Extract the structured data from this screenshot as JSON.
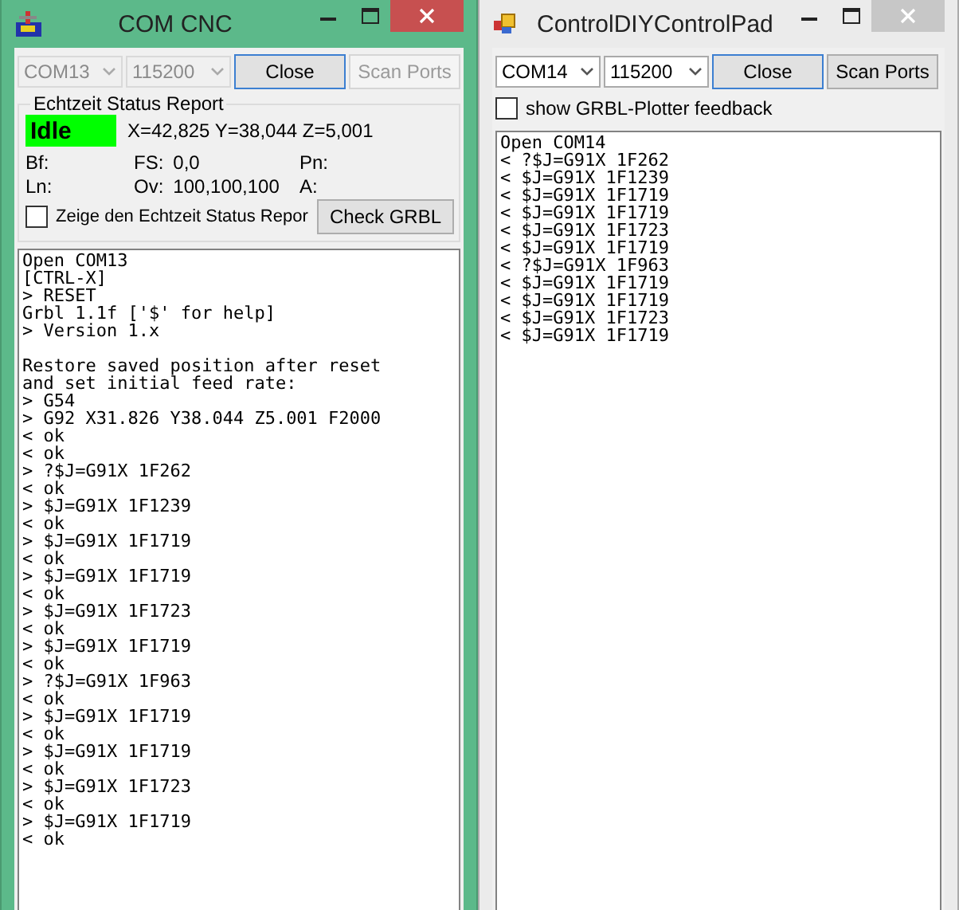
{
  "windows": [
    {
      "kind": "cnc",
      "title": "COM CNC",
      "active": true,
      "port": {
        "value": "COM13",
        "disabled": true
      },
      "baud": {
        "value": "115200",
        "disabled": true
      },
      "buttons": [
        {
          "label": "Close",
          "disabled": false,
          "focused": true
        },
        {
          "label": "Scan Ports",
          "disabled": true,
          "focused": false
        }
      ],
      "status": {
        "title": "Echtzeit Status Report",
        "state": "Idle",
        "position": "X=42,825 Y=38,044 Z=5,001",
        "fields": [
          {
            "label": "Bf:"
          },
          {
            "label": "FS:",
            "value": "0,0"
          },
          {
            "label": "Pn:"
          },
          {
            "label": "Ln:"
          },
          {
            "label": "Ov:",
            "value": "100,100,100"
          },
          {
            "label": "A:"
          }
        ],
        "show_status": {
          "label": "Zeige den Echtzeit Status Repor",
          "checked": false
        },
        "check_button": "Check GRBL"
      },
      "log": [
        [
          "Open COM13",
          "[CTRL-X]",
          "> RESET",
          "Grbl 1.1f ['$' for help]",
          "> Version 1.x"
        ],
        [
          "Restore saved position after reset",
          "and set initial feed rate:",
          "> G54",
          "> G92 X31.826 Y38.044 Z5.001 F2000",
          "< ok",
          "< ok",
          "> ?$J=G91X 1F262",
          "< ok",
          "> $J=G91X 1F1239",
          "< ok",
          "> $J=G91X 1F1719",
          "< ok",
          "> $J=G91X 1F1719",
          "< ok",
          "> $J=G91X 1F1723",
          "< ok",
          "> $J=G91X 1F1719",
          "< ok",
          "> ?$J=G91X 1F963",
          "< ok",
          "> $J=G91X 1F1719",
          "< ok",
          "> $J=G91X 1F1719",
          "< ok",
          "> $J=G91X 1F1723",
          "< ok",
          "> $J=G91X 1F1719",
          "< ok"
        ]
      ]
    },
    {
      "kind": "pad",
      "title": "ControlDIYControlPad",
      "active": false,
      "port": {
        "value": "COM14",
        "disabled": false
      },
      "baud": {
        "value": "115200",
        "disabled": false
      },
      "buttons": [
        {
          "label": "Close",
          "disabled": false,
          "focused": true
        },
        {
          "label": "Scan Ports",
          "disabled": false,
          "focused": false
        }
      ],
      "feedback": {
        "label": "show GRBL-Plotter feedback",
        "checked": false
      },
      "log": [
        [
          "Open COM14",
          "< ?$J=G91X 1F262",
          "< $J=G91X 1F1239",
          "< $J=G91X 1F1719",
          "< $J=G91X 1F1719",
          "< $J=G91X 1F1723",
          "< $J=G91X 1F1719",
          "< ?$J=G91X 1F963",
          "< $J=G91X 1F1719",
          "< $J=G91X 1F1719",
          "< $J=G91X 1F1723",
          "< $J=G91X 1F1719"
        ]
      ]
    }
  ]
}
